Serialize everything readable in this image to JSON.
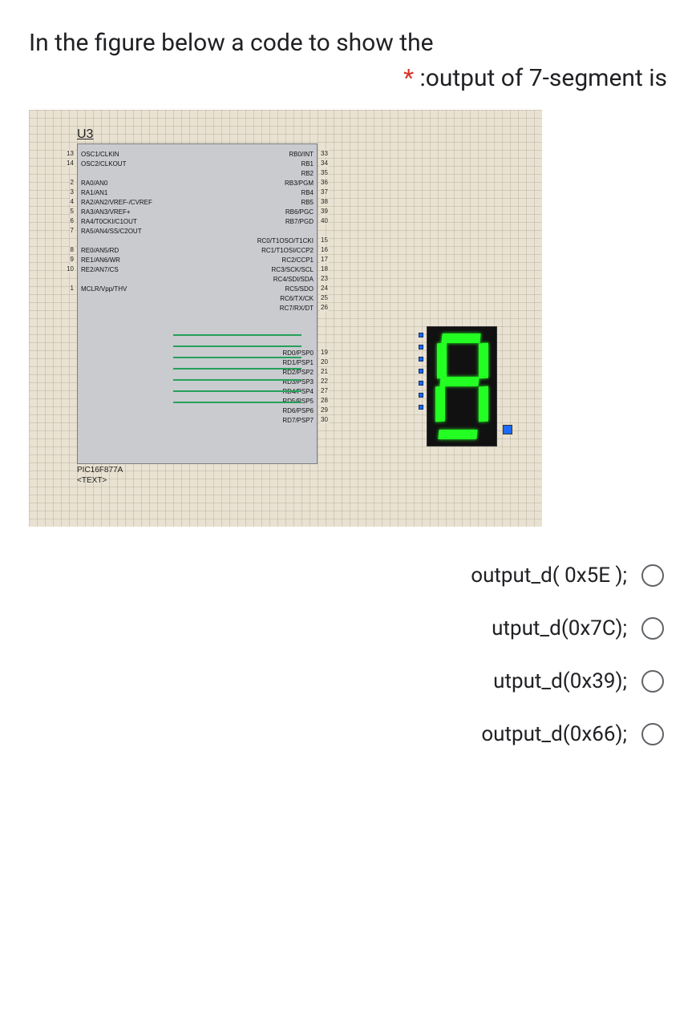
{
  "question": {
    "line1": "In the figure below a code to show the",
    "line2": ":output of 7-segment is",
    "required_mark": "*"
  },
  "chip": {
    "ref": "U3",
    "part": "PIC16F877A",
    "text_prop": "<TEXT>",
    "left_pins": [
      {
        "num": "13",
        "label": "OSC1/CLKIN"
      },
      {
        "num": "14",
        "label": "OSC2/CLKOUT"
      },
      {
        "num": "2",
        "label": "RA0/AN0"
      },
      {
        "num": "3",
        "label": "RA1/AN1"
      },
      {
        "num": "4",
        "label": "RA2/AN2/VREF-/CVREF"
      },
      {
        "num": "5",
        "label": "RA3/AN3/VREF+"
      },
      {
        "num": "6",
        "label": "RA4/T0CKI/C1OUT"
      },
      {
        "num": "7",
        "label": "RA5/AN4/SS/C2OUT"
      },
      {
        "num": "8",
        "label": "RE0/AN5/RD"
      },
      {
        "num": "9",
        "label": "RE1/AN6/WR"
      },
      {
        "num": "10",
        "label": "RE2/AN7/CS"
      },
      {
        "num": "1",
        "label": "MCLR/Vpp/THV"
      }
    ],
    "right_pins": [
      {
        "num": "33",
        "label": "RB0/INT"
      },
      {
        "num": "34",
        "label": "RB1"
      },
      {
        "num": "35",
        "label": "RB2"
      },
      {
        "num": "36",
        "label": "RB3/PGM"
      },
      {
        "num": "37",
        "label": "RB4"
      },
      {
        "num": "38",
        "label": "RB5"
      },
      {
        "num": "39",
        "label": "RB6/PGC"
      },
      {
        "num": "40",
        "label": "RB7/PGD"
      },
      {
        "num": "15",
        "label": "RC0/T1OSO/T1CKI"
      },
      {
        "num": "16",
        "label": "RC1/T1OSI/CCP2"
      },
      {
        "num": "17",
        "label": "RC2/CCP1"
      },
      {
        "num": "18",
        "label": "RC3/SCK/SCL"
      },
      {
        "num": "23",
        "label": "RC4/SDI/SDA"
      },
      {
        "num": "24",
        "label": "RC5/SDO"
      },
      {
        "num": "25",
        "label": "RC6/TX/CK"
      },
      {
        "num": "26",
        "label": "RC7/RX/DT"
      },
      {
        "num": "19",
        "label": "RD0/PSP0"
      },
      {
        "num": "20",
        "label": "RD1/PSP1"
      },
      {
        "num": "21",
        "label": "RD2/PSP2"
      },
      {
        "num": "22",
        "label": "RD3/PSP3"
      },
      {
        "num": "27",
        "label": "RD4/PSP4"
      },
      {
        "num": "28",
        "label": "RD5/PSP5"
      },
      {
        "num": "29",
        "label": "RD6/PSP6"
      },
      {
        "num": "30",
        "label": "RD7/PSP7"
      }
    ]
  },
  "seven_segment": {
    "displayed_digit": "8",
    "segments_on": [
      "a",
      "b",
      "c",
      "d",
      "e",
      "f",
      "g"
    ],
    "dp_on": false
  },
  "options": [
    {
      "label": "output_d( 0x5E );"
    },
    {
      "label": "utput_d(0x7C);"
    },
    {
      "label": "utput_d(0x39);"
    },
    {
      "label": "output_d(0x66);"
    }
  ]
}
